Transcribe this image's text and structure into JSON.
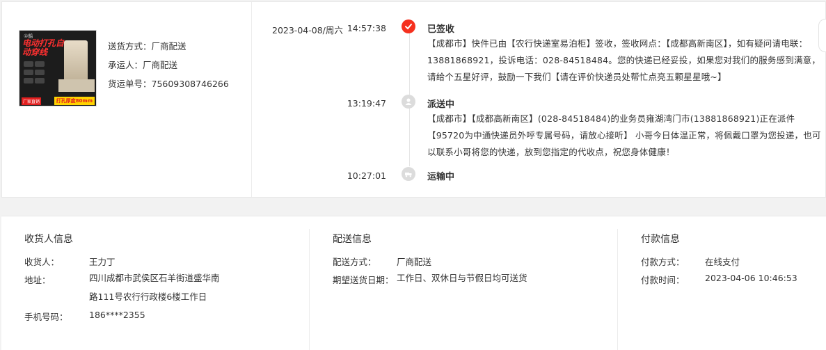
{
  "product": {
    "image_logo": "①船",
    "image_title": "电动打孔自动穿线",
    "image_badge_left": "厂家直销",
    "image_badge_right": "打孔厚度80mm",
    "delivery_method_label": "送货方式：厂商配送",
    "carrier_label": "承运人：厂商配送",
    "tracking_label": "货运单号：75609308746266"
  },
  "timeline": {
    "date": "2023-04-08/周六",
    "events": [
      {
        "time": "14:57:38",
        "status": "已签收",
        "icon": "check-icon",
        "desc": "【成都市】快件已由【农行快递室易泊柜】签收，签收网点：【成都高新南区】，如有疑问请电联：13881868921，投诉电话：028-84518484。您的快递已经妥投，如果您对我们的服务感到满意，请给个五星好评，鼓励一下我们【请在评价快递员处帮忙点亮五颗星星哦~】"
      },
      {
        "time": "13:19:47",
        "status": "派送中",
        "icon": "courier-icon",
        "desc": "【成都市】【成都高新南区】(028-84518484)的业务员雍湖湾门市(13881868921)正在派件【95720为中通快递员外呼专属号码，请放心接听】 小哥今日体温正常，将佩戴口罩为您投递，也可以联系小哥将您的快递，放到您指定的代收点，祝您身体健康！"
      },
      {
        "time": "10:27:01",
        "status": "运输中",
        "icon": "truck-icon",
        "desc": ""
      }
    ]
  },
  "receiver": {
    "title": "收货人信息",
    "name_label": "收货人：",
    "name": "王力丁",
    "address_label": "地址：",
    "address": "四川成都市武侯区石羊街道盛华南路111号农行行政楼6楼工作日",
    "phone_label": "手机号码：",
    "phone": "186****2355"
  },
  "delivery": {
    "title": "配送信息",
    "method_label": "配送方式：",
    "method": "厂商配送",
    "expected_label": "期望送货日期：",
    "expected": "工作日、双休日与节假日均可送货"
  },
  "payment": {
    "title": "付款信息",
    "method_label": "付款方式：",
    "method": "在线支付",
    "time_label": "付款时间：",
    "time": "2023-04-06 10:46:53"
  },
  "colors": {
    "accent": "#f5301e",
    "grey_icon": "#dcdcdc",
    "text": "#333333"
  }
}
